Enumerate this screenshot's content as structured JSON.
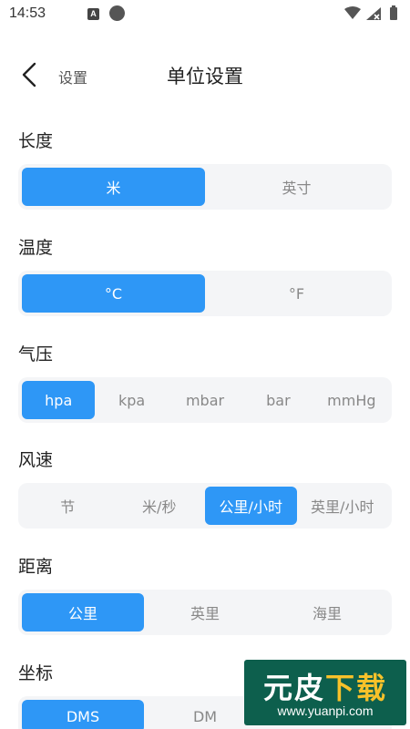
{
  "status_bar": {
    "time": "14:53",
    "notification_letter": "A"
  },
  "header": {
    "back_label": "设置",
    "title": "单位设置"
  },
  "sections": {
    "length": {
      "label": "长度",
      "options": [
        "米",
        "英寸"
      ],
      "selected": "米"
    },
    "temperature": {
      "label": "温度",
      "options": [
        "°C",
        "°F"
      ],
      "selected": "°C"
    },
    "pressure": {
      "label": "气压",
      "options": [
        "hpa",
        "kpa",
        "mbar",
        "bar",
        "mmHg"
      ],
      "selected": "hpa"
    },
    "wind_speed": {
      "label": "风速",
      "options": [
        "节",
        "米/秒",
        "公里/小时",
        "英里/小时"
      ],
      "selected": "公里/小时"
    },
    "distance": {
      "label": "距离",
      "options": [
        "公里",
        "英里",
        "海里"
      ],
      "selected": "公里"
    },
    "coordinate": {
      "label": "坐标",
      "options": [
        "DMS",
        "DM"
      ],
      "selected": "DMS"
    }
  },
  "watermark": {
    "title_part1": "元皮",
    "title_part2": "下载",
    "url": "www.yuanpi.com"
  },
  "colors": {
    "accent": "#2e97f6",
    "segment_bg": "#f4f5f7",
    "watermark_bg": "#0d5f4d"
  }
}
